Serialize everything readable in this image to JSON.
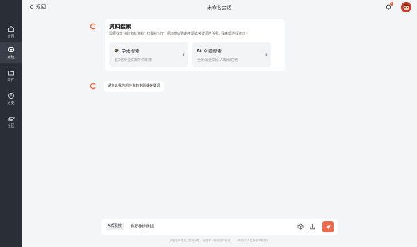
{
  "sidebar": {
    "items": [
      {
        "label": "首页",
        "icon": "home-icon"
      },
      {
        "label": "新建",
        "icon": "new-chat-icon",
        "active": true
      },
      {
        "label": "文件",
        "icon": "folder-icon"
      },
      {
        "label": "历史",
        "icon": "clock-icon"
      },
      {
        "label": "社区",
        "icon": "planet-icon"
      }
    ]
  },
  "header": {
    "back_label": "返回",
    "title": "未命名会话",
    "notification_count": "4"
  },
  "card": {
    "title": "资料搜索",
    "description": "需要找专业的文献资料? 找我就对了! 把你感兴趣的主题或关键词告诉我, 我来帮你找资料~",
    "options": [
      {
        "icon": "graduation-cap-icon",
        "glyph": "🎓",
        "title": "学术搜索",
        "desc": "超2亿专业文献等你来搜"
      },
      {
        "icon": "ai-icon",
        "glyph": "Ai",
        "title": "全网搜索",
        "desc": "全网海量资源, AI帮你总结"
      }
    ]
  },
  "bot_message": "请告诉我你想检索的主题或关键词",
  "composer": {
    "mode_label": "AI帮我搜",
    "input_value": "卷积神经网络",
    "footer_note": "内容由AI生成, 仅供参考。请遵守《帮搜用户协议》、《帮搜个人信息保护规则》"
  },
  "colors": {
    "accent": "#ef6a4a",
    "sidebar_bg": "#2a2e36",
    "page_bg": "#f4f5f7"
  }
}
